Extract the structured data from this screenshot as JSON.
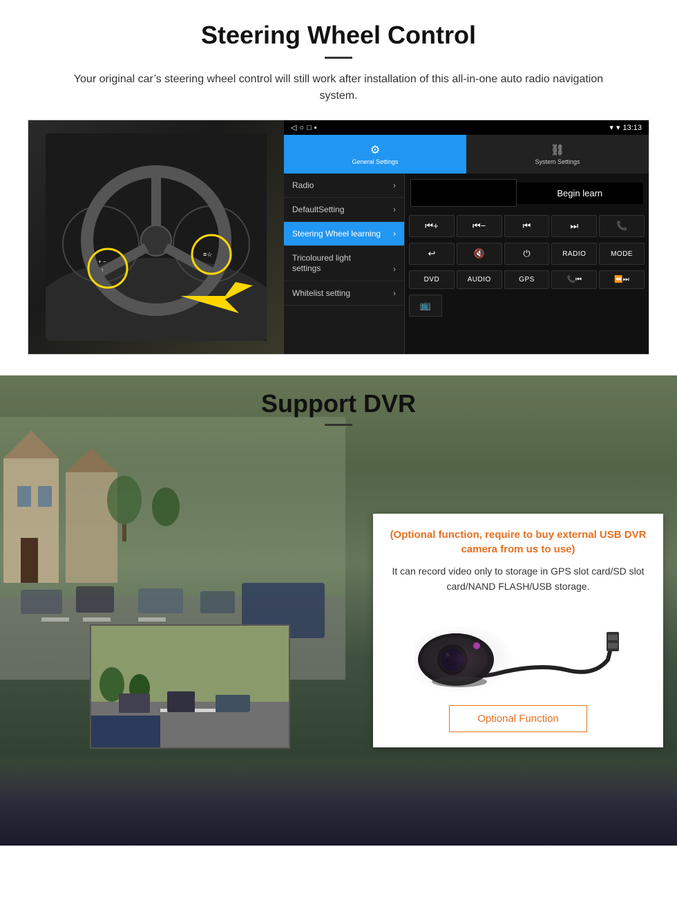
{
  "steering": {
    "title": "Steering Wheel Control",
    "subtitle": "Your original car’s steering wheel control will still work after installation of this all-in-one auto radio navigation system.",
    "android": {
      "statusbar": {
        "time": "13:13",
        "signal": "▾"
      },
      "tabs": [
        {
          "icon": "⚙",
          "label": "General Settings",
          "active": true
        },
        {
          "icon": "⛓",
          "label": "System Settings",
          "active": false
        }
      ],
      "menu_items": [
        {
          "label": "Radio",
          "selected": false
        },
        {
          "label": "DefaultSetting",
          "selected": false
        },
        {
          "label": "Steering Wheel learning",
          "selected": true
        },
        {
          "label": "Tricoloured light settings",
          "selected": false
        },
        {
          "label": "Whitelist setting",
          "selected": false
        }
      ],
      "begin_learn": "Begin learn",
      "ctrl_buttons_row1": [
        "⏮+",
        "⏮-",
        "⏮",
        "⏭",
        "📞"
      ],
      "ctrl_buttons_row2": [
        "↩",
        "🔇",
        "⏻",
        "RADIO",
        "MODE"
      ],
      "ctrl_buttons_row3": [
        "DVD",
        "AUDIO",
        "GPS",
        "📞⏮",
        "⏪⏭"
      ]
    }
  },
  "dvr": {
    "title": "Support DVR",
    "optional_text": "(Optional function, require to buy external USB DVR camera from us to use)",
    "desc_text": "It can record video only to storage in GPS slot card/SD slot card/NAND FLASH/USB storage.",
    "optional_btn": "Optional Function"
  }
}
